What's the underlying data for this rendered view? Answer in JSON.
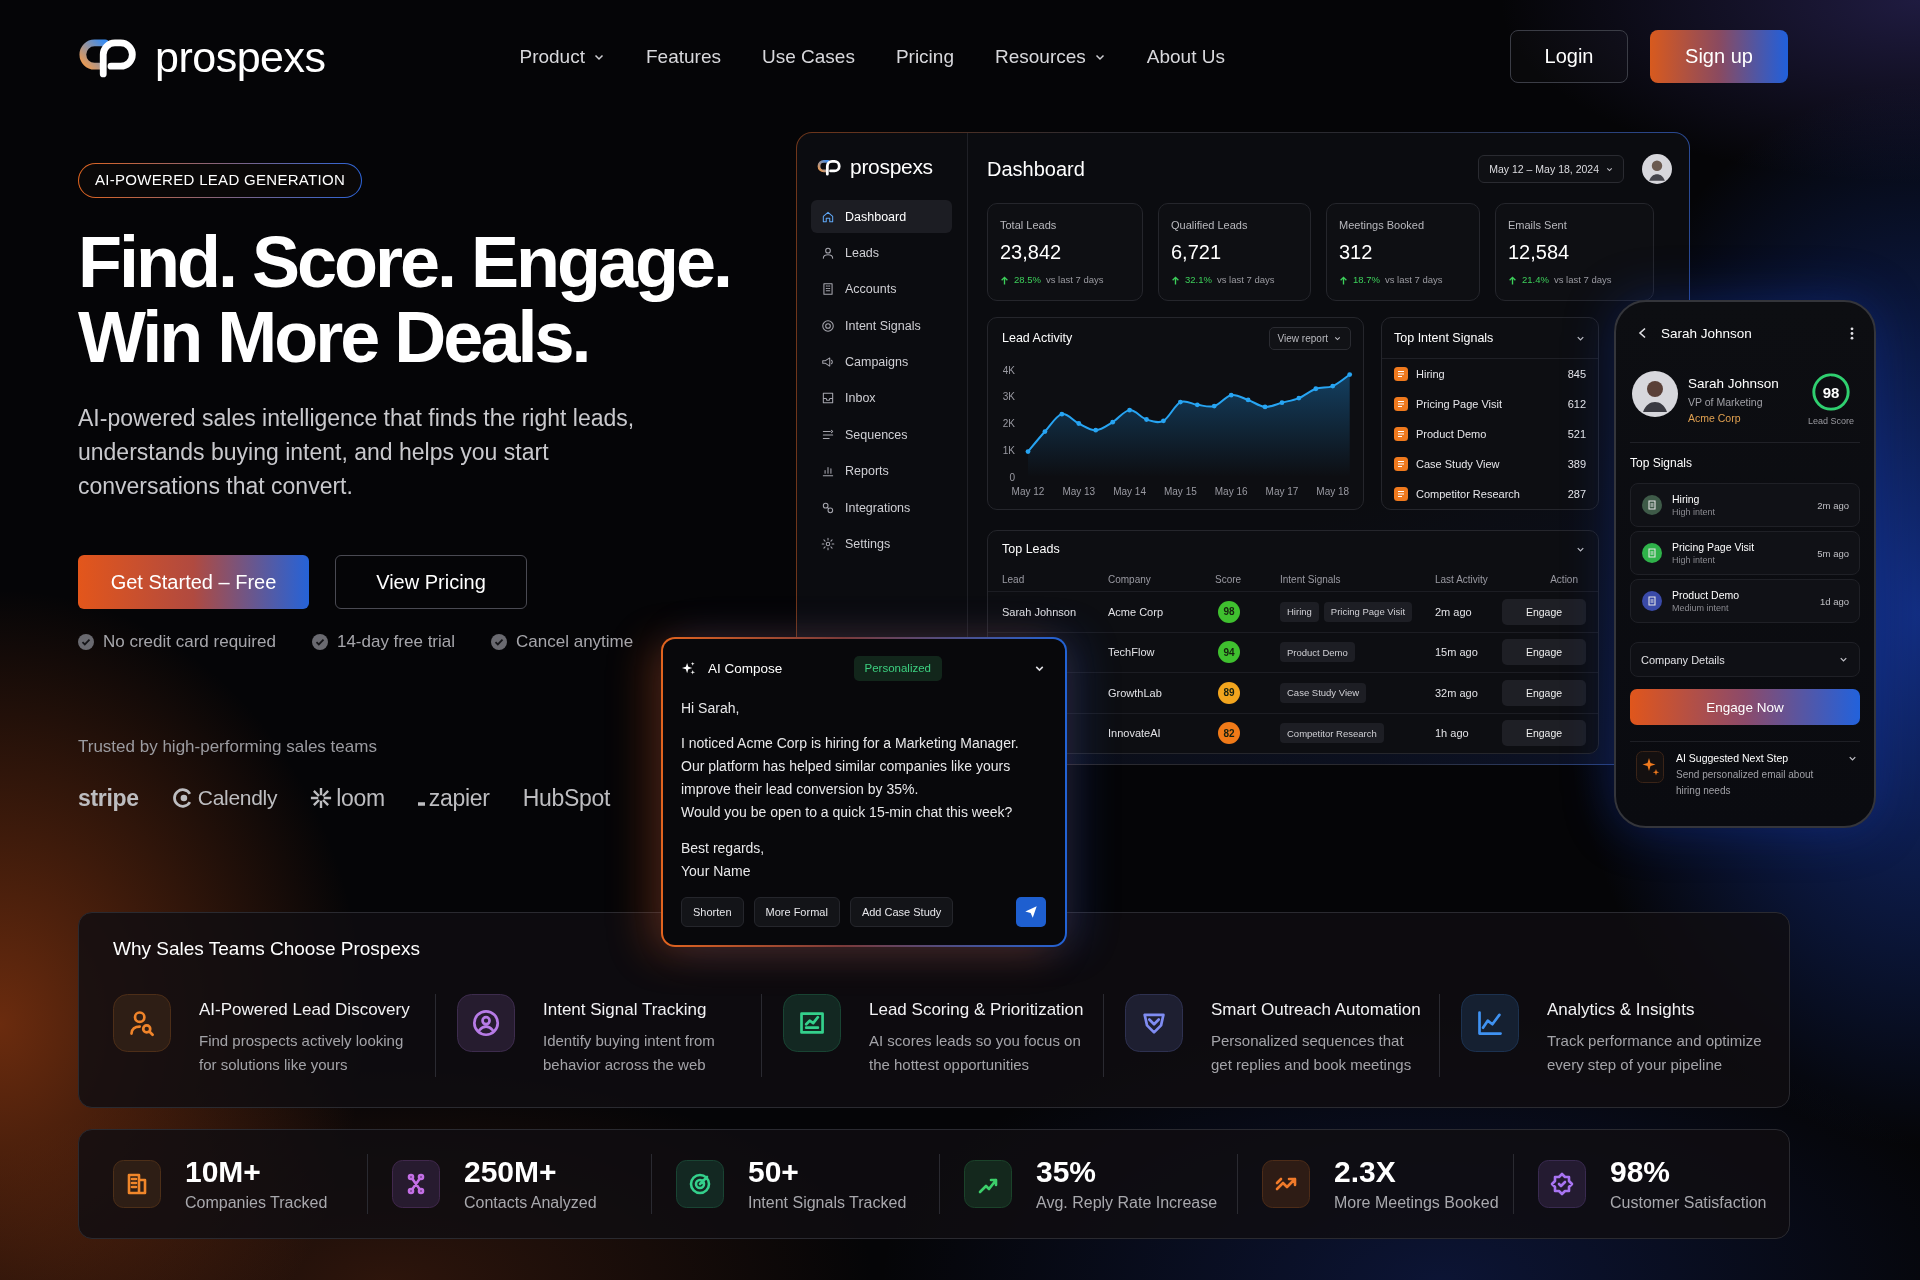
{
  "nav": {
    "logo": "prospexs",
    "links": [
      {
        "label": "Product",
        "has_menu": true
      },
      {
        "label": "Features",
        "has_menu": false
      },
      {
        "label": "Use Cases",
        "has_menu": false
      },
      {
        "label": "Pricing",
        "has_menu": false
      },
      {
        "label": "Resources",
        "has_menu": true
      },
      {
        "label": "About Us",
        "has_menu": false
      }
    ],
    "login": "Login",
    "signup": "Sign up"
  },
  "hero": {
    "badge": "AI-POWERED LEAD GENERATION",
    "headline": [
      "Find. Score. Engage.",
      "Win More Deals."
    ],
    "subtitle": "AI-powered sales intelligence that finds the right leads, understands buying intent, and helps you start conversations that convert.",
    "primary_cta": "Get Started – Free",
    "secondary_cta": "View Pricing",
    "perks": [
      "No credit card required",
      "14-day free trial",
      "Cancel anytime"
    ],
    "trusted_label": "Trusted by high-performing sales teams",
    "logos": [
      {
        "name": "stripe",
        "kind": "bold"
      },
      {
        "name": "Calendly",
        "kind": "ring"
      },
      {
        "name": "loom",
        "kind": "burst"
      },
      {
        "name": "zapier",
        "kind": "dash"
      },
      {
        "name": "HubSpot",
        "kind": "plain"
      }
    ]
  },
  "dashboard": {
    "logo": "prospexs",
    "title": "Dashboard",
    "date_range": "May 12 – May 18, 2024",
    "nav": [
      {
        "label": "Dashboard",
        "selected": true
      },
      {
        "label": "Leads",
        "selected": false
      },
      {
        "label": "Accounts",
        "selected": false
      },
      {
        "label": "Intent Signals",
        "selected": false
      },
      {
        "label": "Campaigns",
        "selected": false
      },
      {
        "label": "Inbox",
        "selected": false
      },
      {
        "label": "Sequences",
        "selected": false
      },
      {
        "label": "Reports",
        "selected": false
      },
      {
        "label": "Integrations",
        "selected": false
      },
      {
        "label": "Settings",
        "selected": false
      }
    ],
    "stats": [
      {
        "label": "Total Leads",
        "value": "23,842",
        "rising": true,
        "change": "28.5%",
        "period": "vs last 7 days"
      },
      {
        "label": "Qualified Leads",
        "value": "6,721",
        "rising": true,
        "change": "32.1%",
        "period": "vs last 7 days"
      },
      {
        "label": "Meetings Booked",
        "value": "312",
        "rising": true,
        "change": "18.7%",
        "period": "vs last 7 days"
      },
      {
        "label": "Emails Sent",
        "value": "12,584",
        "rising": true,
        "change": "21.4%",
        "period": "vs last 7 days"
      }
    ],
    "lead_activity": {
      "title": "Lead Activity",
      "action": "View report",
      "chart_data": {
        "type": "area",
        "categories": [
          "May 12",
          null,
          null,
          "May 13",
          null,
          null,
          "May 14",
          null,
          null,
          "May 15",
          null,
          null,
          "May 16",
          null,
          null,
          "May 17",
          null,
          null,
          "May 18",
          null
        ],
        "values": [
          950,
          1700,
          2350,
          2000,
          1750,
          2050,
          2500,
          2150,
          2100,
          2800,
          2700,
          2650,
          3060,
          2880,
          2620,
          2780,
          2950,
          3300,
          3400,
          3830
        ],
        "ylim": [
          0,
          4000
        ],
        "yticks": [
          {
            "value": 0,
            "label": "0"
          },
          {
            "value": 1000,
            "label": "1K"
          },
          {
            "value": 2000,
            "label": "2K"
          },
          {
            "value": 3000,
            "label": "3K"
          },
          {
            "value": 4000,
            "label": "4K"
          }
        ]
      }
    },
    "top_intent_signals": {
      "title": "Top Intent Signals",
      "items": [
        {
          "label": "Hiring",
          "count": "845"
        },
        {
          "label": "Pricing Page Visit",
          "count": "612"
        },
        {
          "label": "Product Demo",
          "count": "521"
        },
        {
          "label": "Case Study View",
          "count": "389"
        },
        {
          "label": "Competitor Research",
          "count": "287"
        }
      ]
    },
    "top_leads": {
      "title": "Top Leads",
      "columns": [
        "Lead",
        "Company",
        "Score",
        "Intent Signals",
        "Last Activity",
        "Action"
      ],
      "rows": [
        {
          "lead": "Sarah Johnson",
          "company": "Acme Corp",
          "score": "98",
          "color": "#3fc02f",
          "signals": [
            "Hiring",
            "Pricing Page Visit"
          ],
          "last_activity": "2m ago",
          "action": "Engage"
        },
        {
          "company": "TechFlow",
          "score": "94",
          "color": "#3fc02f",
          "signals": [
            "Product Demo"
          ],
          "last_activity": "15m ago",
          "action": "Engage"
        },
        {
          "company": "GrowthLab",
          "score": "89",
          "color": "#f2a51e",
          "signals": [
            "Case Study View"
          ],
          "last_activity": "32m ago",
          "action": "Engage"
        },
        {
          "company": "InnovateAI",
          "score": "82",
          "color": "#f07a18",
          "signals": [
            "Competitor Research"
          ],
          "last_activity": "1h ago",
          "action": "Engage"
        }
      ]
    }
  },
  "phone": {
    "title": "Sarah Johnson",
    "profile": {
      "name": "Sarah Johnson",
      "role": "VP of Marketing",
      "company": "Acme Corp",
      "score": "98",
      "level": 0.98,
      "score_label": "Lead Score"
    },
    "signals_title": "Top Signals",
    "signals": [
      {
        "label": "Hiring",
        "intent": "High intent",
        "time": "2m ago",
        "color": "#3e5a48"
      },
      {
        "label": "Pricing Page Visit",
        "intent": "High intent",
        "time": "5m ago",
        "color": "#2fb24a"
      },
      {
        "label": "Product Demo",
        "intent": "Medium intent",
        "time": "1d ago",
        "color": "#3a4aa8"
      }
    ],
    "company_details": "Company Details",
    "engage": "Engage Now",
    "suggestion": {
      "title": "AI Suggested Next Step",
      "text": "Send personalized email about hiring needs"
    }
  },
  "compose": {
    "title": "AI Compose",
    "tag": "Personalized",
    "greeting": "Hi Sarah,",
    "body": [
      "I noticed Acme Corp is hiring for a Marketing Manager. Our platform has helped similar companies like yours improve their lead conversion by 35%.",
      "Would you be open to a quick 15-min chat this week?"
    ],
    "signoff": [
      "Best regards,",
      "Your Name"
    ],
    "actions": [
      "Shorten",
      "More Formal",
      "Add Case Study"
    ]
  },
  "features": {
    "title": "Why Sales Teams Choose Prospexs",
    "items": [
      {
        "title": "AI-Powered Lead Discovery",
        "text": "Find prospects actively looking for solutions like yours",
        "color": "#f0842a"
      },
      {
        "title": "Intent Signal Tracking",
        "text": "Identify buying intent from behavior across the web",
        "color": "#b77be6"
      },
      {
        "title": "Lead Scoring & Prioritization",
        "text": "AI scores leads so you focus on the hottest opportunities",
        "color": "#34d08c"
      },
      {
        "title": "Smart Outreach Automation",
        "text": "Personalized sequences that get replies and book meetings",
        "color": "#7f8cf2"
      },
      {
        "title": "Analytics & Insights",
        "text": "Track performance and optimize every step of your pipeline",
        "color": "#3f92f2"
      }
    ]
  },
  "stats": [
    {
      "value": "10M+",
      "label": "Companies Tracked",
      "color": "#f0862a"
    },
    {
      "value": "250M+",
      "label": "Contacts Analyzed",
      "color": "#c46fe6"
    },
    {
      "value": "50+",
      "label": "Intent Signals Tracked",
      "color": "#34d08c"
    },
    {
      "value": "35%",
      "label": "Avg. Reply Rate Increase",
      "color": "#3ccf6a"
    },
    {
      "value": "2.3X",
      "label": "More Meetings Booked",
      "color": "#f07a2a"
    },
    {
      "value": "98%",
      "label": "Customer Satisfaction",
      "color": "#a874f2"
    }
  ]
}
